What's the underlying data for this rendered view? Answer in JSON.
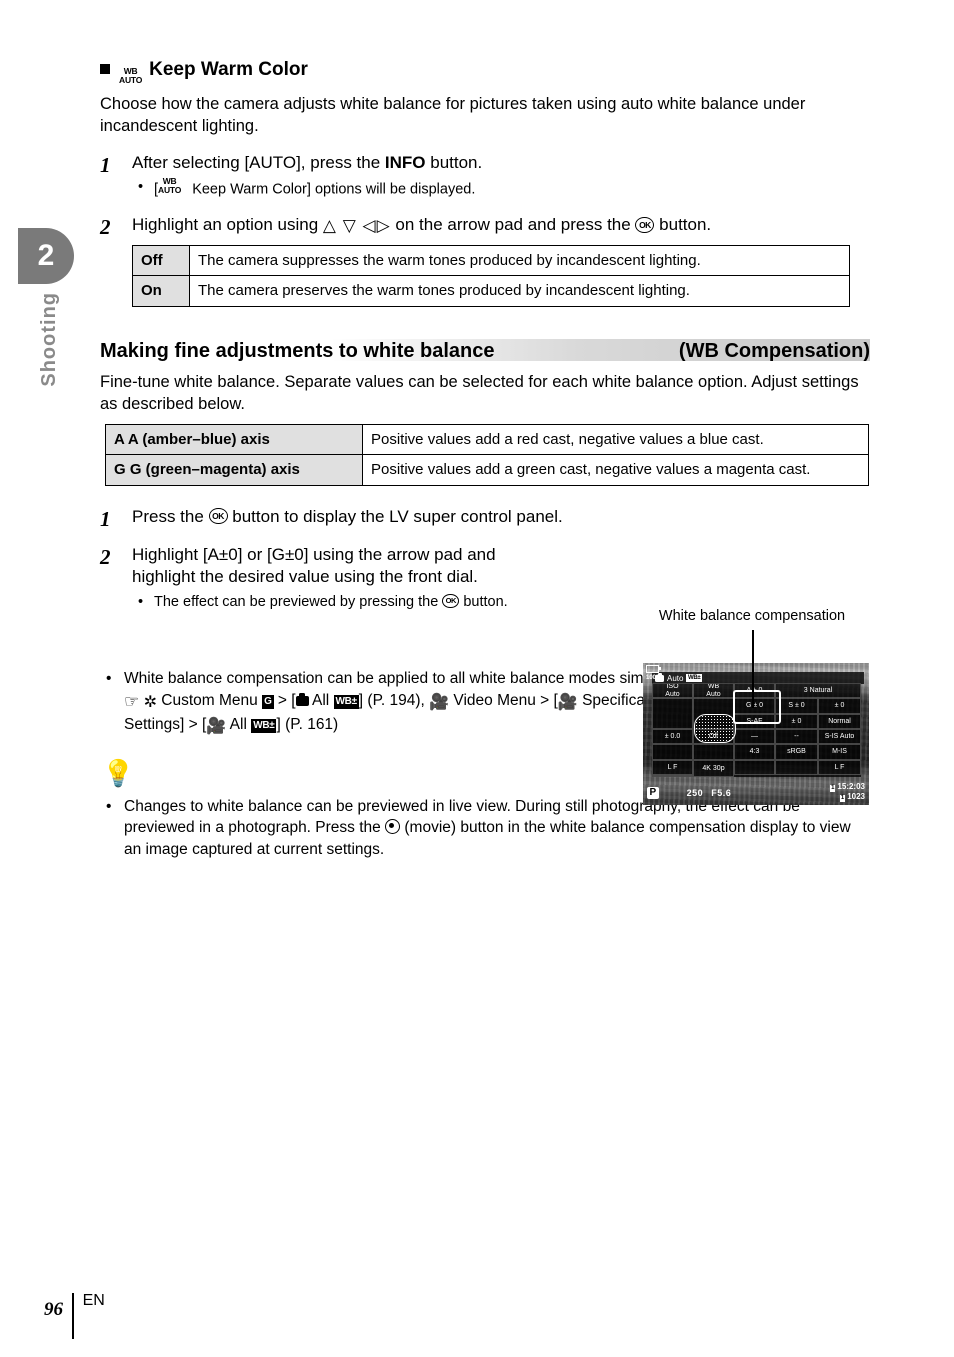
{
  "chapter": {
    "number": "2",
    "name": "Shooting"
  },
  "subsection": {
    "icon_line1": "WB",
    "icon_line2": "AUTO",
    "title": "Keep Warm Color",
    "intro": "Choose how the camera adjusts white balance for pictures taken using auto white balance under incandescent lighting."
  },
  "steps_keepwarm": [
    {
      "num": "1",
      "text_pre": "After selecting [AUTO], press the ",
      "text_bold": "INFO",
      "text_post": " button.",
      "sub_pre": "[",
      "sub_icon1": "WB",
      "sub_icon2": "AUTO",
      "sub_post": " Keep Warm Color] options will be displayed."
    },
    {
      "num": "2",
      "text_pre": "Highlight an option using ",
      "arrows": "△ ▽ ◁▷",
      "text_mid": " on the arrow pad and press the ",
      "ok": "OK",
      "text_post": " button."
    }
  ],
  "table_onoff": {
    "rows": [
      {
        "key": "Off",
        "desc": "The camera suppresses the warm tones produced by incandescent lighting."
      },
      {
        "key": "On",
        "desc": "The camera preserves the warm tones produced by incandescent lighting."
      }
    ]
  },
  "section": {
    "title_left": "Making fine adjustments to white balance",
    "title_right": "(WB Compensation)",
    "intro": "Fine-tune white balance. Separate values can be selected for each white balance option. Adjust settings as described below."
  },
  "table_axis": {
    "rows": [
      {
        "key": "A  A (amber–blue) axis",
        "desc": "Positive values add a red cast, negative values a blue cast."
      },
      {
        "key": "G  G (green–magenta) axis",
        "desc": "Positive values add a green cast, negative values a magenta cast."
      }
    ]
  },
  "steps_wbcomp": [
    {
      "num": "1",
      "text_pre": "Press the ",
      "ok": "OK",
      "text_post": " button to display the LV super control panel."
    },
    {
      "num": "2",
      "line1": "Highlight [A±0] or [G±0] using the arrow pad and",
      "line2": "highlight the desired value using the front dial.",
      "sub_pre": "The effect can be previewed by pressing the ",
      "sub_ok": "OK",
      "sub_post": " button."
    }
  ],
  "figure": {
    "caption": "White balance compensation",
    "lcd": {
      "battery": "100%",
      "topbar": {
        "mode_label": "Auto",
        "wb_badge": "WB±"
      },
      "grid": [
        {
          "label1": "ISO",
          "label2": "Auto"
        },
        {
          "label1": "WB",
          "label2": "Auto"
        },
        {
          "label1": "A ± 0"
        },
        {
          "label1": "3 Natural"
        },
        {
          "label1": ""
        },
        {
          "label1": "G ± 0"
        },
        {
          "label1": "S ± 0"
        },
        {
          "label1": "± 0"
        },
        {
          "label1": "S-AF"
        },
        {
          "label1": "± 0"
        },
        {
          "label1": "Normal"
        },
        {
          "label1": "± 0.0"
        },
        {
          "label1": "Off"
        },
        {
          "label1": "—"
        },
        {
          "label1": "--"
        },
        {
          "label1": "S-IS Auto"
        },
        {
          "label1": "4:3"
        },
        {
          "label1": "sRGB"
        },
        {
          "label1": "M-IS"
        },
        {
          "label1": "L F"
        },
        {
          "label1": "4K 30p"
        },
        {
          "label1": "L F"
        }
      ],
      "bottom": {
        "mode": "P",
        "shutter": "250",
        "aperture": "F5.6",
        "date": "15:2:03",
        "frames": "1023"
      }
    }
  },
  "bullets": [
    {
      "line1": "White balance compensation can be applied to all white balance modes simultaneously.",
      "line2_a": "Custom Menu",
      "line2_badge_g": "G",
      "line2_b": "> [",
      "line2_all": "All",
      "line2_wb": "WB±",
      "line2_c": "] (P. 194),",
      "line2_d": "Video Menu > [",
      "line2_spec": "Specification",
      "line3_a": "Settings] > [",
      "line3_all": "All",
      "line3_wb": "WB±",
      "line3_b": "] (P. 161)"
    }
  ],
  "tips": [
    {
      "text_pre": "Changes to white balance can be previewed in live view. During still photography, the effect can be previewed in a photograph. Press the ",
      "text_post": " (movie) button in the white balance compensation display to view an image captured at current settings."
    }
  ],
  "footer": {
    "page": "96",
    "lang": "EN"
  }
}
